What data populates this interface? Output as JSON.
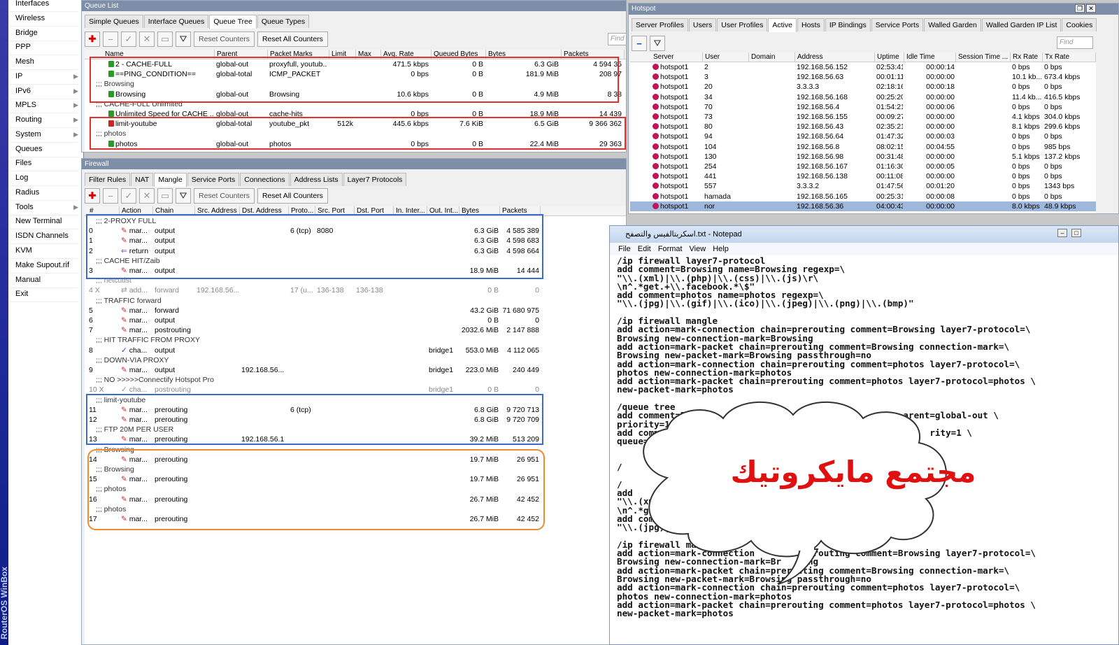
{
  "sidebar": {
    "brand": "RouterOS WinBox",
    "items": [
      {
        "label": "Interfaces",
        "arrow": ""
      },
      {
        "label": "Wireless",
        "arrow": ""
      },
      {
        "label": "Bridge",
        "arrow": ""
      },
      {
        "label": "PPP",
        "arrow": ""
      },
      {
        "label": "Mesh",
        "arrow": ""
      },
      {
        "label": "IP",
        "arrow": "▶"
      },
      {
        "label": "IPv6",
        "arrow": "▶"
      },
      {
        "label": "MPLS",
        "arrow": "▶"
      },
      {
        "label": "Routing",
        "arrow": "▶"
      },
      {
        "label": "System",
        "arrow": "▶"
      },
      {
        "label": "Queues",
        "arrow": ""
      },
      {
        "label": "Files",
        "arrow": ""
      },
      {
        "label": "Log",
        "arrow": ""
      },
      {
        "label": "Radius",
        "arrow": ""
      },
      {
        "label": "Tools",
        "arrow": "▶"
      },
      {
        "label": "New Terminal",
        "arrow": ""
      },
      {
        "label": "ISDN Channels",
        "arrow": ""
      },
      {
        "label": "KVM",
        "arrow": ""
      },
      {
        "label": "Make Supout.rif",
        "arrow": ""
      },
      {
        "label": "Manual",
        "arrow": ""
      },
      {
        "label": "Exit",
        "arrow": ""
      }
    ]
  },
  "queue": {
    "title": "Queue List",
    "tabs": [
      "Simple Queues",
      "Interface Queues",
      "Queue Tree",
      "Queue Types"
    ],
    "reset_counters": "Reset Counters",
    "reset_all": "Reset All Counters",
    "find": "Find",
    "columns": [
      "Name",
      "Parent",
      "Packet Marks",
      "Limit",
      "Max",
      "Avg. Rate",
      "Queued Bytes",
      "Bytes",
      "Packets"
    ],
    "rows": [
      {
        "type": "q",
        "color": "#2a9a2a",
        "c": [
          "2 - CACHE-FULL",
          "global-out",
          "proxyfull, youtub...",
          "",
          "",
          "471.5 kbps",
          "0 B",
          "6.3 GiB",
          "4 594 35"
        ]
      },
      {
        "type": "q",
        "color": "#2a9a2a",
        "c": [
          "==PING_CONDITION==",
          "global-total",
          "ICMP_PACKET",
          "",
          "",
          "0 bps",
          "0 B",
          "181.9 MiB",
          "208 97"
        ]
      },
      {
        "type": "c",
        "text": ";;; Browsing"
      },
      {
        "type": "q",
        "color": "#2a9a2a",
        "c": [
          "Browsing",
          "global-out",
          "Browsing",
          "",
          "",
          "10.6 kbps",
          "0 B",
          "4.9 MiB",
          "8 38"
        ]
      },
      {
        "type": "c",
        "text": ";;; CACHE-FULL Unlimited"
      },
      {
        "type": "q",
        "color": "#2a9a2a",
        "c": [
          "Unlimited Speed for CACHE ...",
          "global-out",
          "cache-hits",
          "",
          "",
          "0 bps",
          "0 B",
          "18.9 MiB",
          "14 439"
        ]
      },
      {
        "type": "q",
        "color": "#cc2222",
        "c": [
          "limit-youtube",
          "global-total",
          "youtube_pkt",
          "512k",
          "",
          "445.6 kbps",
          "7.6 KiB",
          "6.5 GiB",
          "9 366 362"
        ]
      },
      {
        "type": "c",
        "text": ";;; photos"
      },
      {
        "type": "q",
        "color": "#2a9a2a",
        "c": [
          "photos",
          "global-out",
          "photos",
          "",
          "",
          "0 bps",
          "0 B",
          "22.4 MiB",
          "29 363"
        ]
      }
    ]
  },
  "firewall": {
    "title": "Firewall",
    "tabs": [
      "Filter Rules",
      "NAT",
      "Mangle",
      "Service Ports",
      "Connections",
      "Address Lists",
      "Layer7 Protocols"
    ],
    "reset_counters": "Reset Counters",
    "reset_all": "Reset All Counters",
    "columns": [
      "#",
      "Action",
      "Chain",
      "Src. Address",
      "Dst. Address",
      "Proto...",
      "Src. Port",
      "Dst. Port",
      "In. Inter...",
      "Out. Int...",
      "Bytes",
      "Packets"
    ],
    "rows": [
      {
        "type": "c",
        "text": ";;; 2-PROXY FULL"
      },
      {
        "c": [
          "0",
          "mar...",
          "output",
          "",
          "",
          "6 (tcp)",
          "8080",
          "",
          "",
          "",
          "6.3 GiB",
          "4 585 389"
        ],
        "i": "mark"
      },
      {
        "c": [
          "1",
          "mar...",
          "output",
          "",
          "",
          "",
          "",
          "",
          "",
          "",
          "6.3 GiB",
          "4 598 683"
        ],
        "i": "mark"
      },
      {
        "c": [
          "2",
          "return",
          "output",
          "",
          "",
          "",
          "",
          "",
          "",
          "",
          "6.3 GiB",
          "4 598 664"
        ],
        "i": "ret"
      },
      {
        "type": "c",
        "text": ";;; CACHE HIT/Zaib"
      },
      {
        "c": [
          "3",
          "mar...",
          "output",
          "",
          "",
          "",
          "",
          "",
          "",
          "",
          "18.9 MiB",
          "14 444"
        ],
        "i": "mark"
      },
      {
        "type": "c",
        "text": ";;; netcutist"
      },
      {
        "c": [
          "4 X",
          "add...",
          "forward",
          "192.168.56...",
          "",
          "17 (u...",
          "136-138",
          "136-138",
          "",
          "",
          "0 B",
          "0"
        ],
        "i": "add",
        "dis": true
      },
      {
        "type": "c",
        "text": ";;; TRAFFIC forward"
      },
      {
        "c": [
          "5",
          "mar...",
          "forward",
          "",
          "",
          "",
          "",
          "",
          "",
          "",
          "43.2 GiB",
          "71 680 975"
        ],
        "i": "mark"
      },
      {
        "c": [
          "6",
          "mar...",
          "output",
          "",
          "",
          "",
          "",
          "",
          "",
          "",
          "0 B",
          "0"
        ],
        "i": "mark"
      },
      {
        "c": [
          "7",
          "mar...",
          "postrouting",
          "",
          "",
          "",
          "",
          "",
          "",
          "",
          "2032.6 MiB",
          "2 147 888"
        ],
        "i": "mark"
      },
      {
        "type": "c",
        "text": ";;; HIT TRAFFIC FROM PROXY"
      },
      {
        "c": [
          "8",
          "cha...",
          "output",
          "",
          "",
          "",
          "",
          "",
          "",
          "bridge1",
          "553.0 MiB",
          "4 112 065"
        ],
        "i": "chk"
      },
      {
        "type": "c",
        "text": ";;; DOWN-VIA PROXY"
      },
      {
        "c": [
          "9",
          "mar...",
          "output",
          "",
          "192.168.56...",
          "",
          "",
          "",
          "",
          "bridge1",
          "223.0 MiB",
          "240 449"
        ],
        "i": "mark"
      },
      {
        "type": "c",
        "text": ";;; NO >>>>>Connectify Hotspot Pro"
      },
      {
        "c": [
          "10 X",
          "cha...",
          "postrouting",
          "",
          "",
          "",
          "",
          "",
          "",
          "bridge1",
          "0 B",
          "0"
        ],
        "i": "chk",
        "dis": true
      },
      {
        "type": "c",
        "text": ";;; limit-youtube"
      },
      {
        "c": [
          "11",
          "mar...",
          "prerouting",
          "",
          "",
          "6 (tcp)",
          "",
          "",
          "",
          "",
          "6.8 GiB",
          "9 720 713"
        ],
        "i": "mark"
      },
      {
        "c": [
          "12",
          "mar...",
          "prerouting",
          "",
          "",
          "",
          "",
          "",
          "",
          "",
          "6.8 GiB",
          "9 720 709"
        ],
        "i": "mark"
      },
      {
        "type": "c",
        "text": ";;; FTP 20M PER USER"
      },
      {
        "c": [
          "13",
          "mar...",
          "prerouting",
          "",
          "192.168.56.1",
          "",
          "",
          "",
          "",
          "",
          "39.2 MiB",
          "513 209"
        ],
        "i": "mark"
      },
      {
        "type": "c",
        "text": ";;; Browsing"
      },
      {
        "c": [
          "14",
          "mar...",
          "prerouting",
          "",
          "",
          "",
          "",
          "",
          "",
          "",
          "19.7 MiB",
          "26 951"
        ],
        "i": "mark"
      },
      {
        "type": "c",
        "text": ";;; Browsing"
      },
      {
        "c": [
          "15",
          "mar...",
          "prerouting",
          "",
          "",
          "",
          "",
          "",
          "",
          "",
          "19.7 MiB",
          "26 951"
        ],
        "i": "mark"
      },
      {
        "type": "c",
        "text": ";;; photos"
      },
      {
        "c": [
          "16",
          "mar...",
          "prerouting",
          "",
          "",
          "",
          "",
          "",
          "",
          "",
          "26.7 MiB",
          "42 452"
        ],
        "i": "mark"
      },
      {
        "type": "c",
        "text": ";;; photos"
      },
      {
        "c": [
          "17",
          "mar...",
          "prerouting",
          "",
          "",
          "",
          "",
          "",
          "",
          "",
          "26.7 MiB",
          "42 452"
        ],
        "i": "mark"
      }
    ]
  },
  "hotspot": {
    "title": "Hotspot",
    "tabs": [
      "Server Profiles",
      "Users",
      "User Profiles",
      "Active",
      "Hosts",
      "IP Bindings",
      "Service Ports",
      "Walled Garden",
      "Walled Garden IP List",
      "Cookies"
    ],
    "find": "Find",
    "columns": [
      "Server",
      "User",
      "Domain",
      "Address",
      "Uptime",
      "Idle Time",
      "Session Time ...",
      "Rx Rate",
      "Tx Rate"
    ],
    "rows": [
      [
        "hotspot1",
        "2",
        "",
        "192.168.56.152",
        "02:53:41",
        "00:00:14",
        "",
        "0 bps",
        "0 bps"
      ],
      [
        "hotspot1",
        "3",
        "",
        "192.168.56.63",
        "00:01:11",
        "00:00:00",
        "",
        "10.1 kb...",
        "673.4 kbps"
      ],
      [
        "hotspot1",
        "20",
        "",
        "3.3.3.3",
        "02:18:16",
        "00:00:18",
        "",
        "0 bps",
        "0 bps"
      ],
      [
        "hotspot1",
        "34",
        "",
        "192.168.56.168",
        "00:25:20",
        "00:00:00",
        "",
        "11.4 kb...",
        "416.5 kbps"
      ],
      [
        "hotspot1",
        "70",
        "",
        "192.168.56.4",
        "01:54:21",
        "00:00:06",
        "",
        "0 bps",
        "0 bps"
      ],
      [
        "hotspot1",
        "73",
        "",
        "192.168.56.155",
        "00:09:27",
        "00:00:00",
        "",
        "4.1 kbps",
        "304.0 kbps"
      ],
      [
        "hotspot1",
        "80",
        "",
        "192.168.56.43",
        "02:35:21",
        "00:00:00",
        "",
        "8.1 kbps",
        "299.6 kbps"
      ],
      [
        "hotspot1",
        "94",
        "",
        "192.168.56.64",
        "01:47:32",
        "00:00:03",
        "",
        "0 bps",
        "0 bps"
      ],
      [
        "hotspot1",
        "104",
        "",
        "192.168.56.8",
        "08:02:15",
        "00:04:55",
        "",
        "0 bps",
        "985 bps"
      ],
      [
        "hotspot1",
        "130",
        "",
        "192.168.56.98",
        "00:31:48",
        "00:00:00",
        "",
        "5.1 kbps",
        "137.2 kbps"
      ],
      [
        "hotspot1",
        "254",
        "",
        "192.168.56.167",
        "01:16:30",
        "00:00:05",
        "",
        "0 bps",
        "0 bps"
      ],
      [
        "hotspot1",
        "441",
        "",
        "192.168.56.138",
        "00:11:08",
        "00:00:00",
        "",
        "0 bps",
        "0 bps"
      ],
      [
        "hotspot1",
        "557",
        "",
        "3.3.3.2",
        "01:47:56",
        "00:01:20",
        "",
        "0 bps",
        "1343 bps"
      ],
      [
        "hotspot1",
        "hamada",
        "",
        "192.168.56.165",
        "00:25:31",
        "00:00:08",
        "",
        "0 bps",
        "0 bps"
      ],
      [
        "hotspot1",
        "nor",
        "",
        "192.168.56.36",
        "04:00:43",
        "00:00:00",
        "",
        "8.0 kbps",
        "48.9 kbps"
      ]
    ]
  },
  "notepad": {
    "title": "اسكربتالفيس والتصفح.txt - Notepad",
    "menu": [
      "File",
      "Edit",
      "Format",
      "View",
      "Help"
    ],
    "text": "/ip firewall layer7-protocol\nadd comment=Browsing name=Browsing regexp=\\\n\"\\\\.(xml)|\\\\.(php)|\\\\.(css)|\\\\.(js)\\r\\\n\\n^.*get.+\\\\.facebook.*\\$\"\nadd comment=photos name=photos regexp=\\\n\"\\\\.(jpg)|\\\\.(gif)|\\\\.(ico)|\\\\.(jpeg)|\\\\.(png)|\\\\.(bmp)\"\n\n/ip firewall mangle\nadd action=mark-connection chain=prerouting comment=Browsing layer7-protocol=\\\nBrowsing new-connection-mark=Browsing\nadd action=mark-packet chain=prerouting comment=Browsing connection-mark=\\\nBrowsing new-packet-mark=Browsing passthrough=no\nadd action=mark-connection chain=prerouting comment=photos layer7-protocol=\\\nphotos new-connection-mark=photos\nadd action=mark-packet chain=prerouting comment=photos layer7-protocol=photos \\\nnew-packet-mark=photos\n\n/queue tree\nadd comment=B                                         arent=global-out \\\npriority=1\nadd comme                                                  rity=1 \\\nqueue=def\n\n\n/\n\n/\nadd\n\"\\\\.(xml\n\\n^.*get\nadd comme\n\"\\\\.(jpg)|\\\\.(\n\n/ip firewall mangle\nadd action=mark-connection       -prerouting comment=Browsing layer7-protocol=\\\nBrowsing new-connection-mark=Br    ing\nadd action=mark-packet chain=prerouting comment=Browsing connection-mark=\\\nBrowsing new-packet-mark=Browsing passthrough=no\nadd action=mark-connection chain=prerouting comment=photos layer7-protocol=\\\nphotos new-connection-mark=photos\nadd action=mark-packet chain=prerouting comment=photos layer7-protocol=photos \\\nnew-packet-mark=photos"
  },
  "watermark": {
    "text": "مجتمع مايكروتيك",
    "color": "#e01010"
  }
}
